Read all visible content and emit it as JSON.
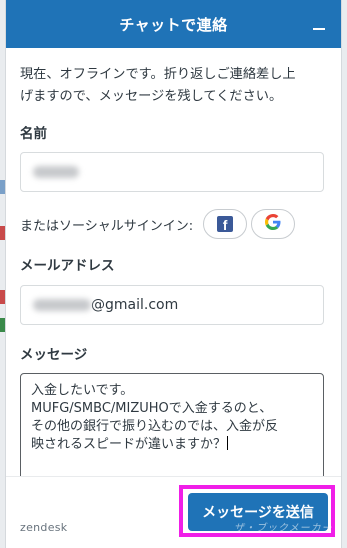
{
  "header": {
    "title": "チャットで連絡",
    "minimize_icon": "minus-icon"
  },
  "intro": {
    "line1": "現在、オフラインです。折り返しご連絡差し上",
    "line2": "げますので、メッセージを残してください。"
  },
  "form": {
    "name_label": "名前",
    "social_label": "またはソーシャルサインイン:",
    "social_buttons": [
      {
        "icon": "facebook-icon",
        "glyph": "f",
        "color": "#3b5998"
      },
      {
        "icon": "google-icon",
        "glyph": "G",
        "color": "#4285f4"
      }
    ],
    "email_label": "メールアドレス",
    "email_suffix": "@gmail.com",
    "message_label": "メッセージ",
    "message_lines": [
      "入金したいです。",
      "MUFG/SMBC/MIZUHOで入金するのと、",
      "その他の銀行で振り込むのでは、入金が反",
      "映されるスピードが違いますか？"
    ]
  },
  "footer": {
    "brand": "zendesk",
    "send_label": "メッセージを送信",
    "watermark": "ザ・ブックメーカーズ"
  },
  "colors": {
    "accent": "#1f73b7",
    "highlight": "#f01ee8"
  }
}
